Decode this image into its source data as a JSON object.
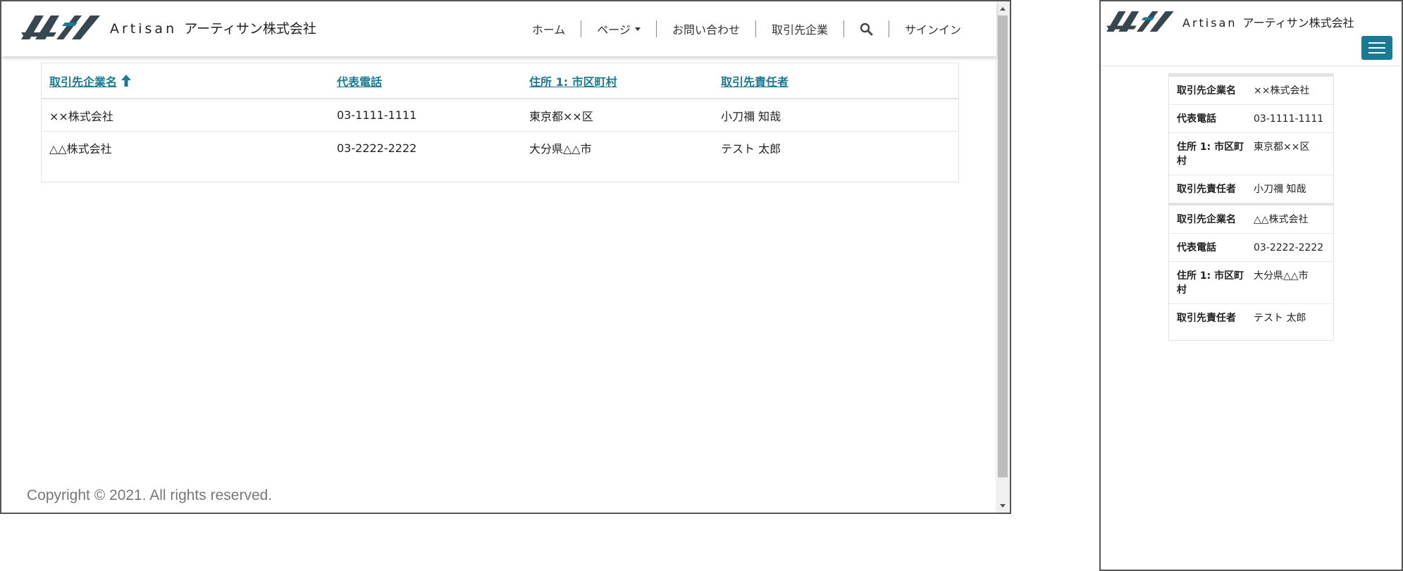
{
  "brand": {
    "latin": "Artisan",
    "name": "アーティサン株式会社",
    "accent": "#1b7a93"
  },
  "nav": {
    "items": [
      {
        "label": "ホーム"
      },
      {
        "label": "ページ",
        "icon": "caret-down-icon"
      },
      {
        "label": "お問い合わせ"
      },
      {
        "label": "取引先企業"
      },
      {
        "label": "",
        "icon": "search-icon"
      },
      {
        "label": "サインイン"
      }
    ]
  },
  "table": {
    "headers": [
      "取引先企業名",
      "代表電話",
      "住所 1: 市区町村",
      "取引先責任者"
    ],
    "sort_icon": "arrow-up-icon",
    "rows": [
      [
        "××株式会社",
        "03-1111-1111",
        "東京都××区",
        "小刀禰 知哉"
      ],
      [
        "△△株式会社",
        "03-2222-2222",
        "大分県△△市",
        "テスト 太郎"
      ]
    ]
  },
  "mobile": {
    "labels": [
      "取引先企業名",
      "代表電話",
      "住所 1: 市区町\n村",
      "取引先責任者"
    ],
    "menu_icon": "hamburger-menu-icon"
  },
  "footer": {
    "copyright": "Copyright © 2021. All rights reserved."
  }
}
